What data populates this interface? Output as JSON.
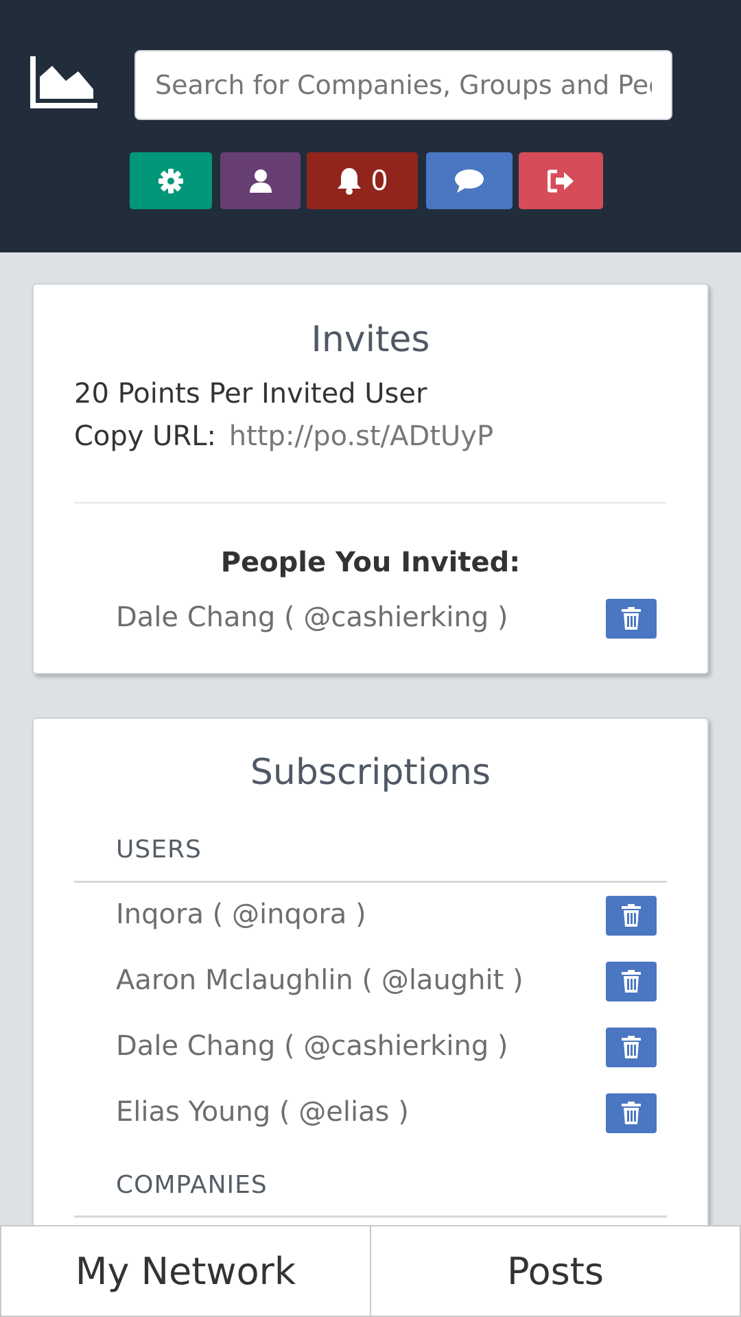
{
  "header": {
    "logo_icon": "area-chart-logo-icon",
    "search_placeholder": "Search for Companies, Groups and People",
    "buttons": [
      {
        "icon": "gear-icon",
        "color": "#009879"
      },
      {
        "icon": "user-icon",
        "color": "#673f72"
      },
      {
        "icon": "bell-icon",
        "color": "#91251c",
        "count": "0"
      },
      {
        "icon": "chat-icon",
        "color": "#4a76c2"
      },
      {
        "icon": "sign-out-icon",
        "color": "#d64c59"
      }
    ]
  },
  "invites": {
    "title": "Invites",
    "points_text": "20 Points Per Invited User",
    "copy_label": "Copy URL:",
    "copy_url": "http://po.st/ADtUyP",
    "people_heading": "People You Invited:",
    "people": [
      {
        "name": "Dale Chang ( @cashierking )"
      }
    ]
  },
  "subscriptions": {
    "title": "Subscriptions",
    "users_label": "USERS",
    "users": [
      {
        "name": "Inqora ( @inqora )"
      },
      {
        "name": "Aaron Mclaughlin ( @laughit )"
      },
      {
        "name": "Dale Chang ( @cashierking )"
      },
      {
        "name": "Elias Young ( @elias )"
      }
    ],
    "companies_label": "COMPANIES"
  },
  "tabs": [
    {
      "label": "My Network"
    },
    {
      "label": "Posts"
    }
  ]
}
